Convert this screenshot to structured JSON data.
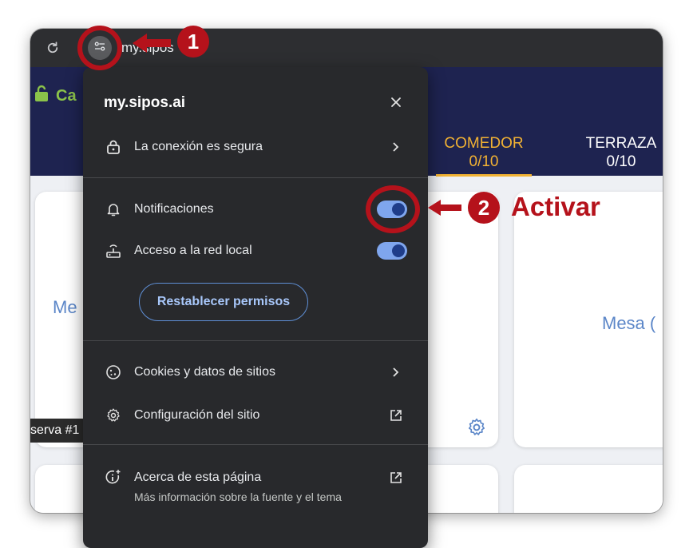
{
  "browser": {
    "url": "my.sipos",
    "icons": {
      "reload": "reload-icon",
      "site_info": "tune-icon"
    }
  },
  "app": {
    "header_label": "Ca",
    "tabs": [
      {
        "name": "COMEDOR",
        "count": "0/10",
        "active": true
      },
      {
        "name": "TERRAZA",
        "count": "0/10",
        "active": false
      }
    ],
    "cards": {
      "mesa_1": "Me",
      "mesa_2": "Mesa (",
      "reserva": "serva #1"
    },
    "colors": {
      "header_bg": "#1e2350",
      "active_tab": "#f2b233",
      "mesa_text": "#5b86c8"
    }
  },
  "popup": {
    "title": "my.sipos.ai",
    "connection": "La conexión es segura",
    "notifications": {
      "label": "Notificaciones",
      "enabled": true
    },
    "local_network": {
      "label": "Acceso a la red local",
      "enabled": true
    },
    "reset_button": "Restablecer permisos",
    "cookies": "Cookies y datos de sitios",
    "site_settings": "Configuración del sitio",
    "about": {
      "label": "Acerca de esta página",
      "sub": "Más información sobre la fuente y el tema"
    }
  },
  "annotations": {
    "step_1": "1",
    "step_2": "2",
    "step_2_text": "Activar",
    "color": "#b5121b"
  }
}
